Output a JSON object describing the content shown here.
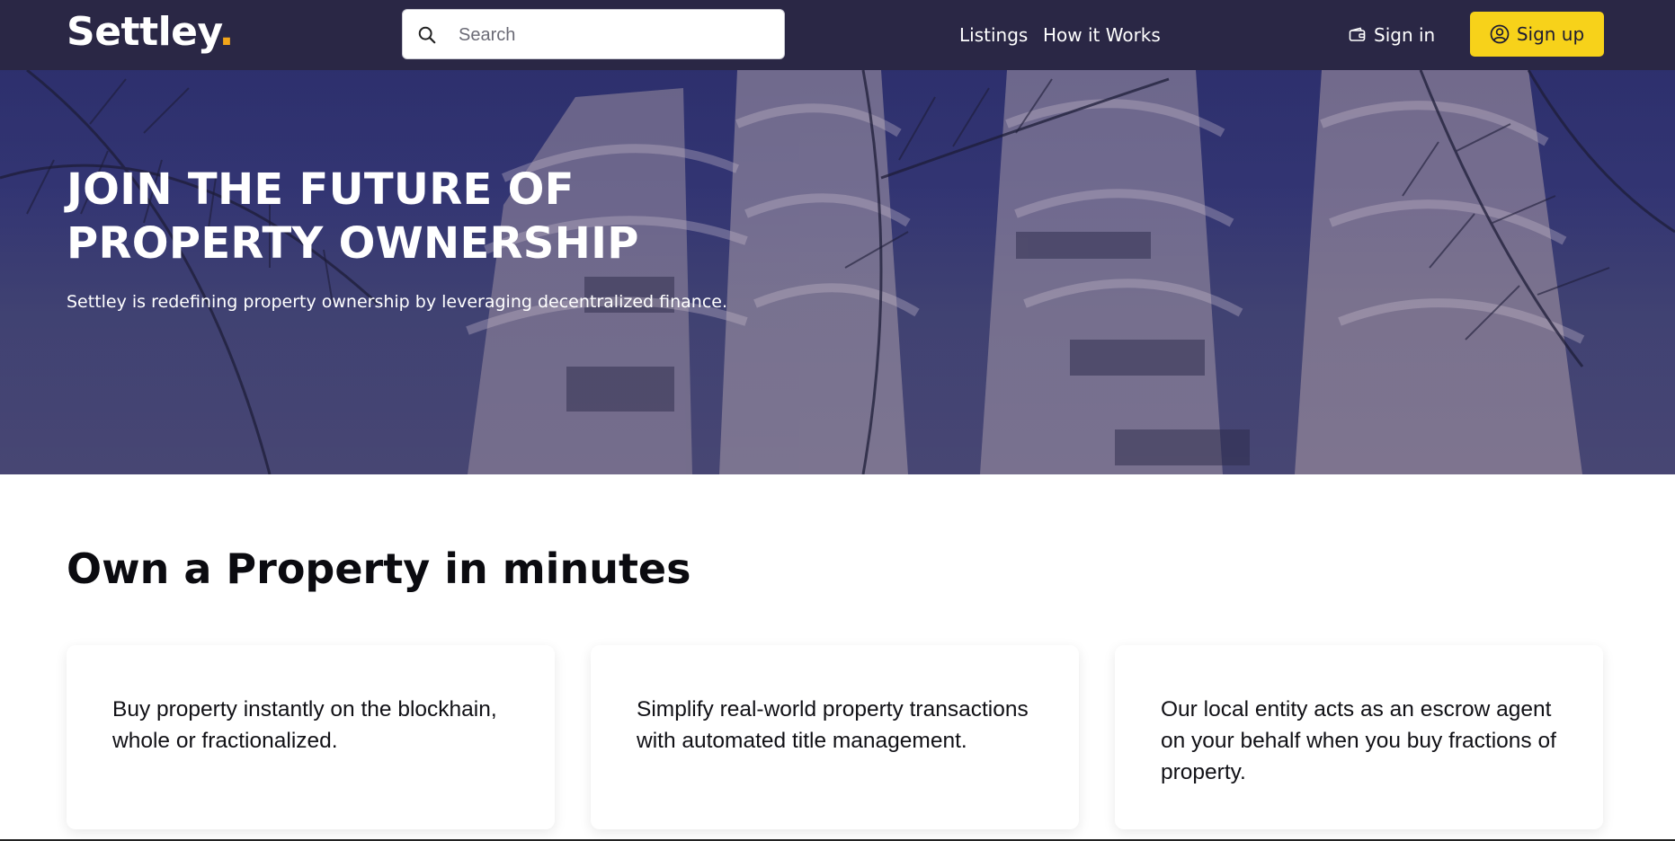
{
  "header": {
    "logo_text": "Settley",
    "logo_dot": ".",
    "search_placeholder": "Search",
    "nav": [
      {
        "label": "Listings"
      },
      {
        "label": "How it Works"
      }
    ],
    "sign_in_label": "Sign in",
    "sign_up_label": "Sign up"
  },
  "hero": {
    "title": "JOIN THE FUTURE OF PROPERTY OWNERSHIP",
    "subtitle": "Settley is redefining property ownership by leveraging decentralized finance."
  },
  "section": {
    "title": "Own a Property in minutes",
    "cards": [
      {
        "text": "Buy property instantly on the blockhain, whole or fractionalized."
      },
      {
        "text": "Simplify real-world property transactions with automated title management."
      },
      {
        "text": "Our local entity acts as an escrow agent on your behalf when you buy fractions of property."
      }
    ]
  },
  "colors": {
    "nav_bg": "#2a2745",
    "accent_dot": "#f2a51a",
    "signup_bg": "#f7d21a",
    "hero_overlay": "#343262"
  },
  "icons": {
    "search": "search-icon",
    "wallet": "wallet-icon",
    "user": "user-circle-icon"
  }
}
